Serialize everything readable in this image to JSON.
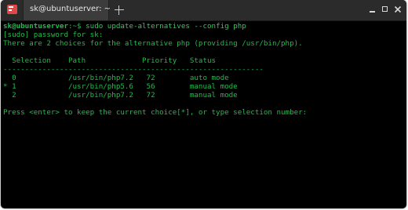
{
  "window": {
    "tab_title": "sk@ubuntuserver: ~",
    "icons": {
      "app": "terminal-icon",
      "new_tab": "plus-icon",
      "minimize": "minimize-icon",
      "maximize": "maximize-icon",
      "close": "close-icon"
    }
  },
  "colors": {
    "terminal_bg": "#000000",
    "terminal_text": "#1fbd4a",
    "titlebar_bg": "#2b2b2b",
    "tab_bg": "#3c3c3c",
    "app_icon": "#e04848"
  },
  "terminal": {
    "prompt_user": "sk@ubuntuserver",
    "prompt_path": ":~$ ",
    "command": "sudo update-alternatives --config php",
    "lines": [
      "[sudo] password for sk:",
      "There are 2 choices for the alternative php (providing /usr/bin/php).",
      "",
      "  Selection    Path             Priority   Status",
      "------------------------------------------------------------",
      "  0            /usr/bin/php7.2   72        auto mode",
      "* 1            /usr/bin/php5.6   56        manual mode",
      "  2            /usr/bin/php7.2   72        manual mode",
      "",
      "Press <enter> to keep the current choice[*], or type selection number: "
    ]
  }
}
